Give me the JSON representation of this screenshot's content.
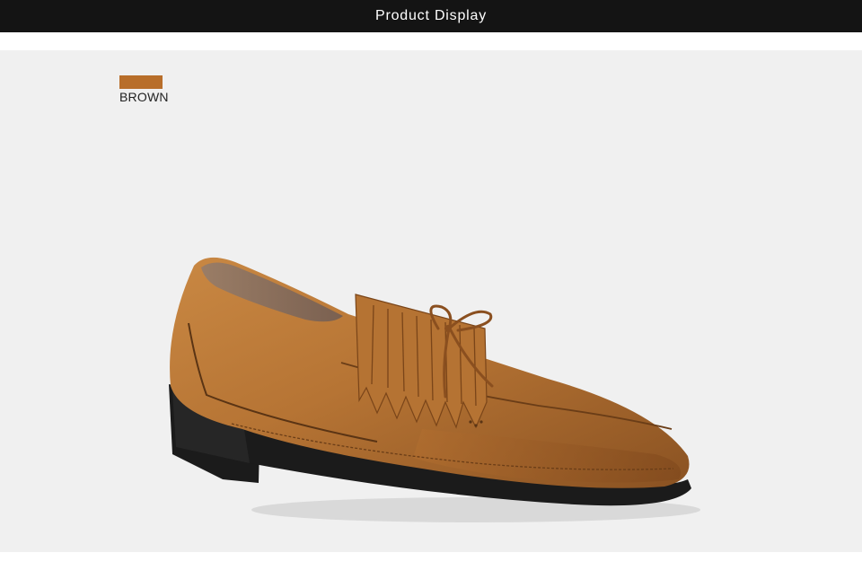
{
  "header": {
    "title": "Product Display",
    "background": "#141414",
    "text_color": "#ffffff"
  },
  "stage": {
    "background": "#f0f0f0"
  },
  "color_option": {
    "label": "BROWN",
    "swatch_color": "#b86e2a"
  },
  "product_image": {
    "icon": "loafer-shoe-image",
    "upper_color": "#b67434",
    "sole_color": "#1b1b1b"
  }
}
